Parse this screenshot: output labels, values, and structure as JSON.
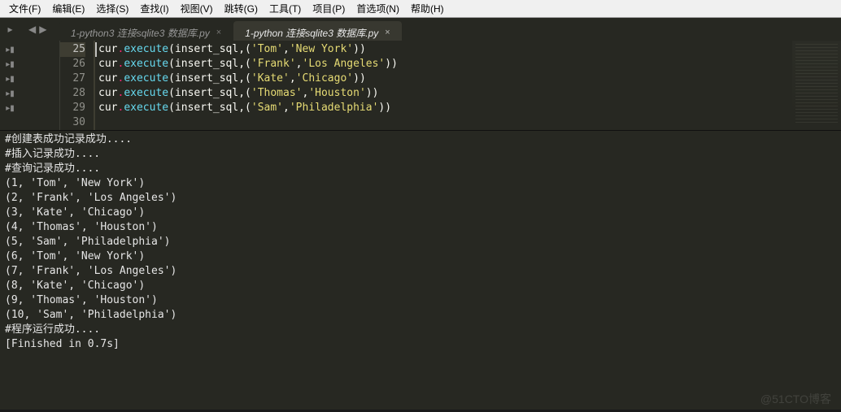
{
  "menu": {
    "file": "文件(F)",
    "edit": "编辑(E)",
    "select": "选择(S)",
    "find": "查找(I)",
    "view": "视图(V)",
    "goto": "跳转(G)",
    "tools": "工具(T)",
    "project": "项目(P)",
    "prefs": "首选项(N)",
    "help": "帮助(H)"
  },
  "tabs": [
    {
      "label": "1-python3 连接sqlite3 数据库.py",
      "active": false
    },
    {
      "label": "1-python 连接sqlite3 数据库.py",
      "active": true
    }
  ],
  "gutter": {
    "start": 25,
    "end": 30,
    "current": 25
  },
  "code_lines": [
    {
      "var": "cur",
      "func": "execute",
      "arg1": "insert_sql",
      "s1": "'Tom'",
      "s2": "'New York'"
    },
    {
      "var": "cur",
      "func": "execute",
      "arg1": "insert_sql",
      "s1": "'Frank'",
      "s2": "'Los Angeles'"
    },
    {
      "var": "cur",
      "func": "execute",
      "arg1": "insert_sql",
      "s1": "'Kate'",
      "s2": "'Chicago'"
    },
    {
      "var": "cur",
      "func": "execute",
      "arg1": "insert_sql",
      "s1": "'Thomas'",
      "s2": "'Houston'"
    },
    {
      "var": "cur",
      "func": "execute",
      "arg1": "insert_sql",
      "s1": "'Sam'",
      "s2": "'Philadelphia'"
    }
  ],
  "console_lines": [
    "#创建表成功记录成功....",
    "#插入记录成功....",
    "#查询记录成功....",
    "(1, 'Tom', 'New York')",
    "(2, 'Frank', 'Los Angeles')",
    "(3, 'Kate', 'Chicago')",
    "(4, 'Thomas', 'Houston')",
    "(5, 'Sam', 'Philadelphia')",
    "(6, 'Tom', 'New York')",
    "(7, 'Frank', 'Los Angeles')",
    "(8, 'Kate', 'Chicago')",
    "(9, 'Thomas', 'Houston')",
    "(10, 'Sam', 'Philadelphia')",
    "#程序运行成功....",
    "[Finished in 0.7s]"
  ],
  "watermark": "@51CTO博客"
}
